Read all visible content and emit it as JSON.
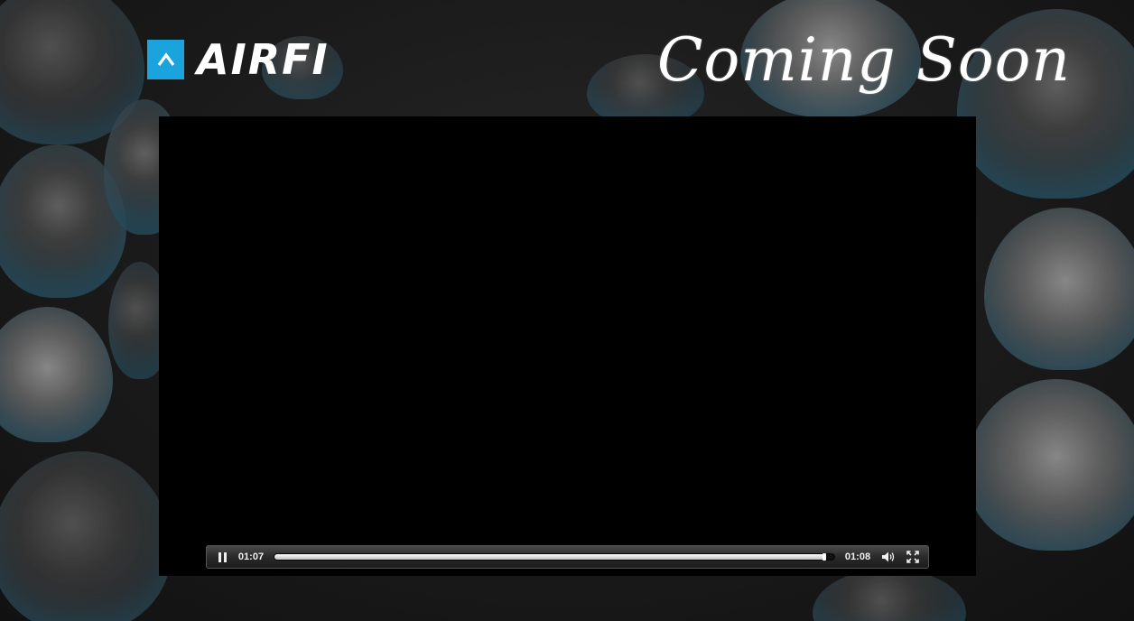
{
  "header": {
    "logo_text": "AIRFI",
    "headline": "Coming Soon"
  },
  "player": {
    "state": "playing",
    "current_time": "01:07",
    "total_time": "01:08",
    "progress": 0.985,
    "icons": {
      "pause": "pause-icon",
      "volume": "volume-icon",
      "fullscreen": "fullscreen-icon"
    }
  },
  "colors": {
    "brand_blue": "#1aa3dd",
    "video_bg": "#000000",
    "page_bg": "#161616"
  }
}
